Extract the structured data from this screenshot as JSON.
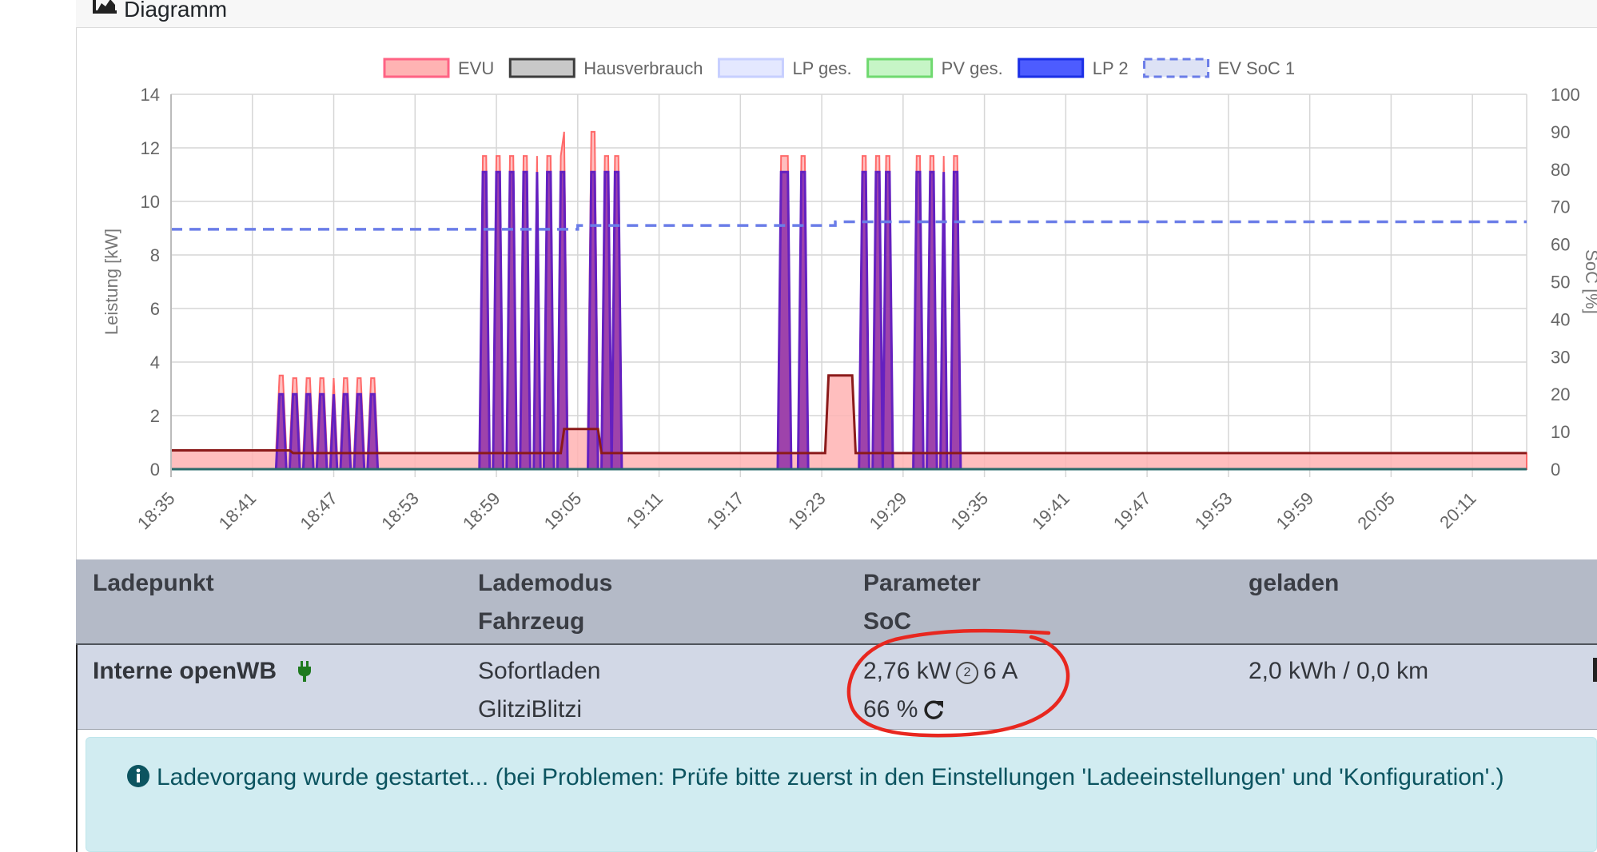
{
  "card": {
    "title": "Diagramm",
    "icon": "chart-area-icon"
  },
  "chart_data": {
    "type": "area",
    "legend_position": "top",
    "x_label": "",
    "y_left_label": "Leistung [kW]",
    "y_right_label": "SoC [%]",
    "y_left_range": [
      0,
      14
    ],
    "y_left_ticks": [
      "0",
      "2",
      "4",
      "6",
      "8",
      "10",
      "12",
      "14"
    ],
    "y_right_range": [
      0,
      100
    ],
    "y_right_ticks": [
      "0",
      "10",
      "20",
      "30",
      "40",
      "50",
      "60",
      "70",
      "80",
      "90",
      "100"
    ],
    "x_range": [
      "18:35",
      "20:15"
    ],
    "x_ticks": [
      "18:35",
      "18:41",
      "18:47",
      "18:53",
      "18:59",
      "19:05",
      "19:11",
      "19:17",
      "19:23",
      "19:29",
      "19:35",
      "19:41",
      "19:47",
      "19:53",
      "19:59",
      "20:05",
      "20:11"
    ],
    "grid": true,
    "series": [
      {
        "name": "EVU",
        "color": "#ff6384",
        "fill": "#ffb3b3",
        "dashed": false
      },
      {
        "name": "Hausverbrauch",
        "color": "#3c3c3c",
        "fill": "#c8c8c8",
        "dashed": false
      },
      {
        "name": "LP ges.",
        "color": "#c7cfff",
        "fill": "#e4e8ff",
        "dashed": false
      },
      {
        "name": "PV ges.",
        "color": "#6fd96f",
        "fill": "#c6f5c6",
        "dashed": false
      },
      {
        "name": "LP 2",
        "color": "#1a2ee6",
        "fill": "#4d5cff",
        "dashed": false
      },
      {
        "name": "EV SoC 1",
        "color": "#6b7de8",
        "fill": "#dde2f5",
        "dashed": true
      }
    ],
    "house_baseline_kw": 0.6,
    "lp2_pulses": [
      {
        "start": "18:43",
        "end": "18:50",
        "count": 8,
        "peak_kw": 2.8
      },
      {
        "start": "18:58",
        "end": "19:04",
        "count": 7,
        "peak_kw": 11.1
      },
      {
        "start": "19:06",
        "end": "19:08",
        "count": 3,
        "peak_kw": 11.1
      },
      {
        "start": "19:20",
        "end": "19:22",
        "count": 2,
        "peak_kw": 11.1
      },
      {
        "start": "19:26",
        "end": "19:28",
        "count": 3,
        "peak_kw": 11.1
      },
      {
        "start": "19:30",
        "end": "19:33",
        "count": 4,
        "peak_kw": 11.1
      }
    ],
    "soc_steps": [
      {
        "x": "18:35",
        "soc": 64
      },
      {
        "x": "19:05",
        "soc": 65
      },
      {
        "x": "19:24",
        "soc": 66
      },
      {
        "x": "20:15",
        "soc": 66
      }
    ]
  },
  "table": {
    "headers": {
      "col1": "Ladepunkt",
      "col2_line1": "Lademodus",
      "col2_line2": "Fahrzeug",
      "col3_line1": "Parameter",
      "col3_line2": "SoC",
      "col4": "geladen"
    },
    "rows": [
      {
        "ladepunkt": "Interne openWB",
        "plug_icon": "plug-icon",
        "lademodus": "Sofortladen",
        "fahrzeug": "GlitziBlitzi",
        "power": "2,76 kW",
        "phases": "2",
        "current": "6 A",
        "soc": "66 %",
        "refresh_icon": "refresh-icon",
        "geladen": "2,0 kWh / 0,0 km"
      }
    ]
  },
  "alert": {
    "icon": "info-circle-icon",
    "text": "Ladevorgang wurde gestartet... (bei Problemen: Prüfe bitte zuerst in den Einstellungen 'Ladeeinstellungen' und 'Konfiguration'.)"
  },
  "annotation_color": "#e8271f"
}
